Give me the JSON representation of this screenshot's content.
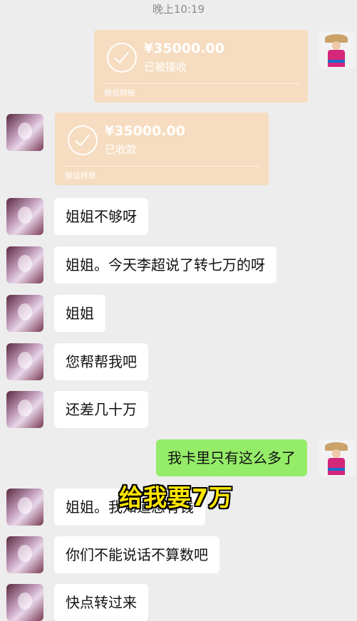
{
  "status_bar": {
    "time": "晚上10:19"
  },
  "messages": [
    {
      "type": "transfer",
      "sender": "me",
      "amount": "¥35000.00",
      "status": "已被接收",
      "footer": "微信转账"
    },
    {
      "type": "transfer",
      "sender": "other",
      "amount": "¥35000.00",
      "status": "已收款",
      "footer": "微信转账"
    },
    {
      "type": "text",
      "sender": "other",
      "text": "姐姐不够呀"
    },
    {
      "type": "text",
      "sender": "other",
      "text": "姐姐。今天李超说了转七万的呀"
    },
    {
      "type": "text",
      "sender": "other",
      "text": "姐姐"
    },
    {
      "type": "text",
      "sender": "other",
      "text": "您帮帮我吧"
    },
    {
      "type": "text",
      "sender": "other",
      "text": "还差几十万"
    },
    {
      "type": "text",
      "sender": "me",
      "text": "我卡里只有这么多了"
    },
    {
      "type": "text",
      "sender": "other",
      "text": "姐姐。我知道您有钱"
    },
    {
      "type": "text",
      "sender": "other",
      "text": "你们不能说话不算数吧"
    },
    {
      "type": "text",
      "sender": "other",
      "text": "快点转过来"
    }
  ],
  "overlay_caption": "给我要7万",
  "colors": {
    "background": "#ededed",
    "my_bubble": "#95ec69",
    "their_bubble": "#ffffff",
    "transfer_card": "#f6dcc0"
  }
}
